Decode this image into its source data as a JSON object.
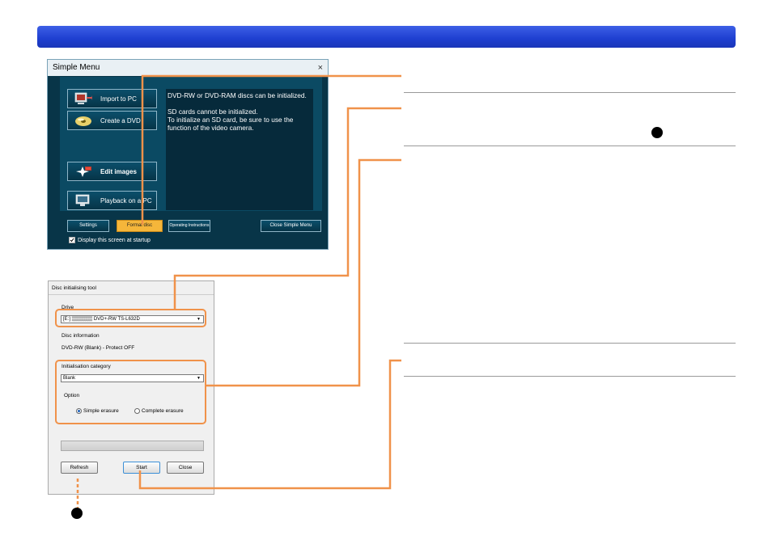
{
  "simple_menu": {
    "title": "Simple Menu",
    "close_glyph": "×",
    "buttons": [
      {
        "label": "Import to PC",
        "icon": "import-to-pc-icon"
      },
      {
        "label": "Create a DVD",
        "icon": "dvd-disc-icon"
      },
      {
        "label": "Edit images",
        "icon": "edit-images-icon"
      },
      {
        "label": "Playback on a PC",
        "icon": "monitor-playback-icon"
      }
    ],
    "description": [
      "DVD-RW or DVD-RAM discs can be initialized.",
      "",
      "SD cards cannot be initialized.",
      "To initialize an SD card, be sure to use the",
      "function of the video camera."
    ],
    "bottom_buttons": {
      "settings": "Settings",
      "format_disc": "Format disc",
      "operating_instructions": "Operating Instructions",
      "close_simple_menu": "Close Simple Menu"
    },
    "startup_checkbox": "Display this screen at startup",
    "colors": {
      "window_bg": "#083548",
      "panel_bg": "#0b4a63",
      "accent": "#f5b63a"
    }
  },
  "disc_tool": {
    "title": "Disc initialising tool",
    "drive_label": "Drive",
    "drive_value": "[E:] ▒▒▒▒▒▒ DVD+-RW TS-L632D",
    "disc_info_label": "Disc information",
    "disc_info_value": "DVD-RW (Blank) - Protect OFF",
    "category_label": "Initialisation category",
    "category_value": "Blank",
    "option_label": "Option",
    "radio_simple": "Simple erasure",
    "radio_complete": "Complete erasure",
    "buttons": {
      "refresh": "Refresh",
      "start": "Start",
      "close": "Close"
    }
  },
  "colors": {
    "header_bar": "#2446d8",
    "callout": "#f0924a"
  }
}
